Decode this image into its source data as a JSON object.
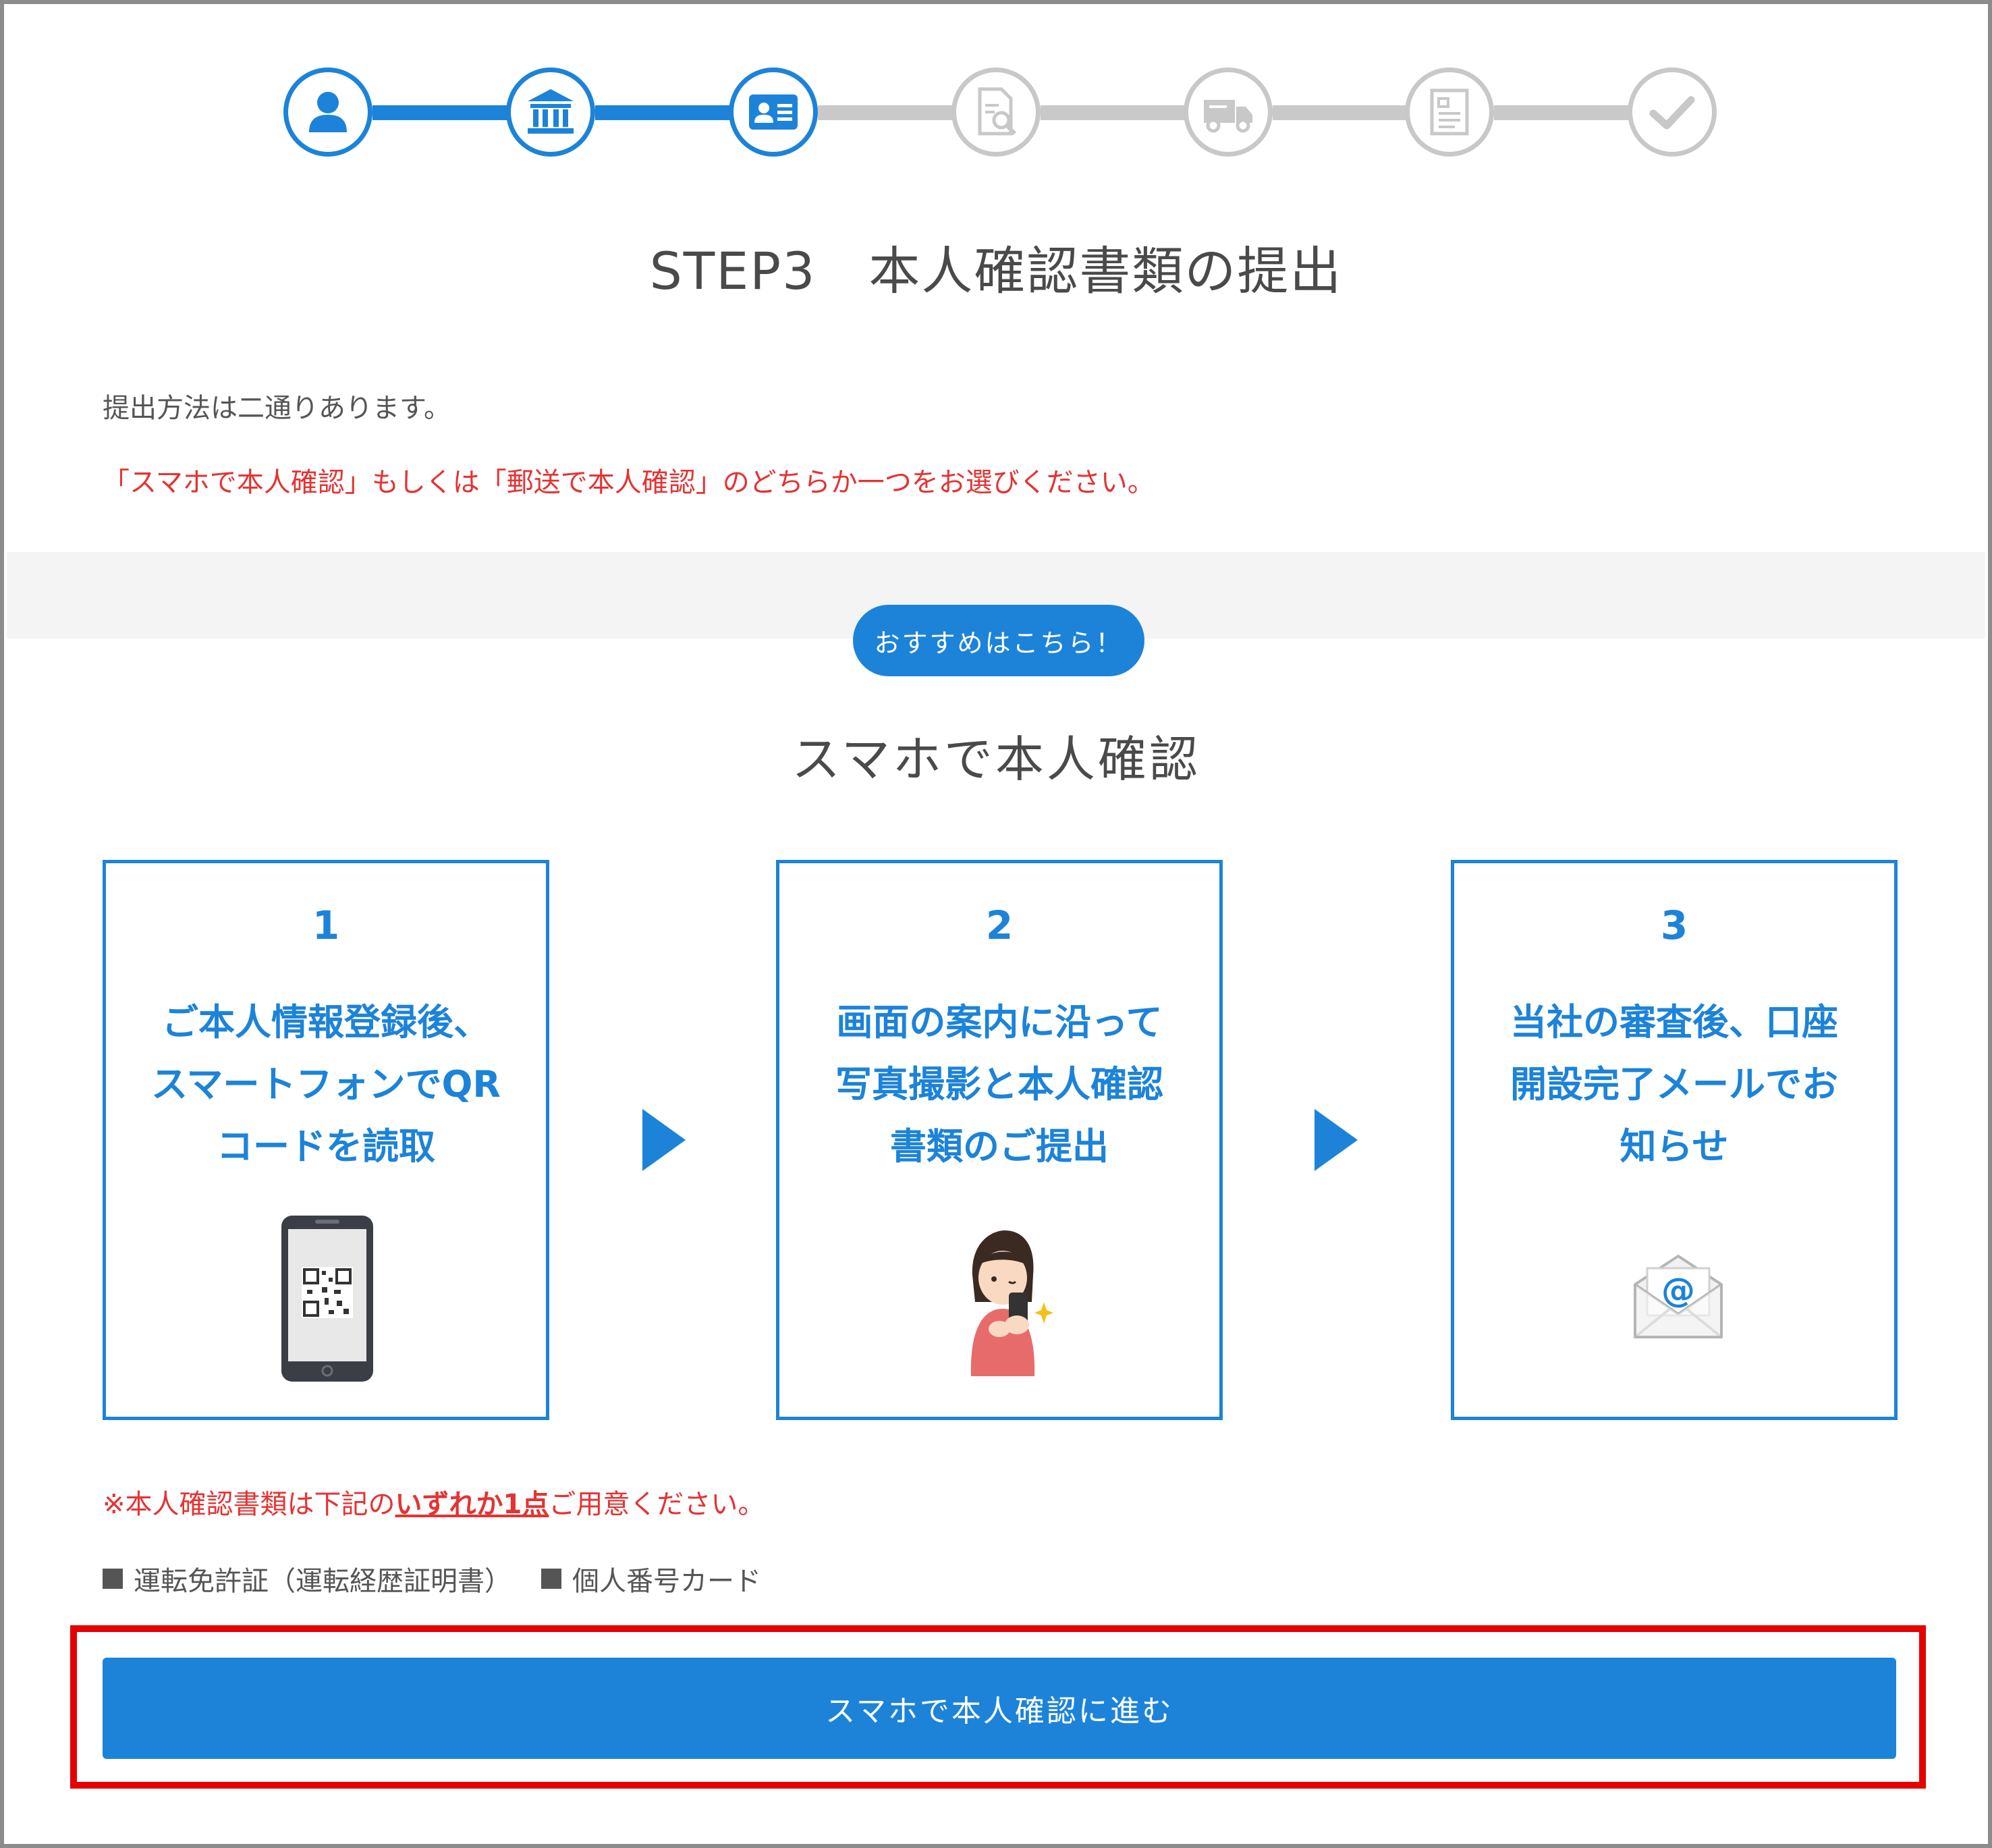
{
  "stepper": {
    "steps": [
      {
        "icon": "user-icon",
        "state": "active"
      },
      {
        "icon": "bank-icon",
        "state": "active"
      },
      {
        "icon": "id-card-icon",
        "state": "active"
      },
      {
        "icon": "document-search-icon",
        "state": "inactive"
      },
      {
        "icon": "delivery-truck-icon",
        "state": "inactive"
      },
      {
        "icon": "document-icon",
        "state": "inactive"
      },
      {
        "icon": "checkmark-icon",
        "state": "inactive"
      }
    ],
    "active_color": "#1c83d9",
    "inactive_color": "#c8c8c8"
  },
  "header": {
    "title": "STEP3　本人確認書類の提出"
  },
  "intro": {
    "line1": "提出方法は二通りあります。",
    "line2": "「スマホで本人確認」もしくは「郵送で本人確認」のどちらか一つをお選びください。"
  },
  "recommend": {
    "label": "おすすめはこちら！"
  },
  "section": {
    "title": "スマホで本人確認"
  },
  "cards": [
    {
      "number": "1",
      "text": "ご本人情報登録後、\nスマートフォンでQR\nコードを読取",
      "illustration": "smartphone-qr-icon"
    },
    {
      "number": "2",
      "text": "画面の案内に沿って\n写真撮影と本人確認\n書類のご提出",
      "illustration": "woman-with-phone-icon"
    },
    {
      "number": "3",
      "text": "当社の審査後、口座\n開設完了メールでお\n知らせ",
      "illustration": "email-envelope-icon"
    }
  ],
  "note": {
    "prefix": "※本人確認書類は下記の",
    "emphasis": "いずれか1点",
    "suffix": "ご用意ください。"
  },
  "documents": [
    "運転免許証（運転経歴証明書）",
    "個人番号カード"
  ],
  "actions": {
    "proceed_label": "スマホで本人確認に進む"
  },
  "colors": {
    "accent": "#1c83d9",
    "warning_red": "#e53333",
    "highlight_red": "#e60000"
  }
}
